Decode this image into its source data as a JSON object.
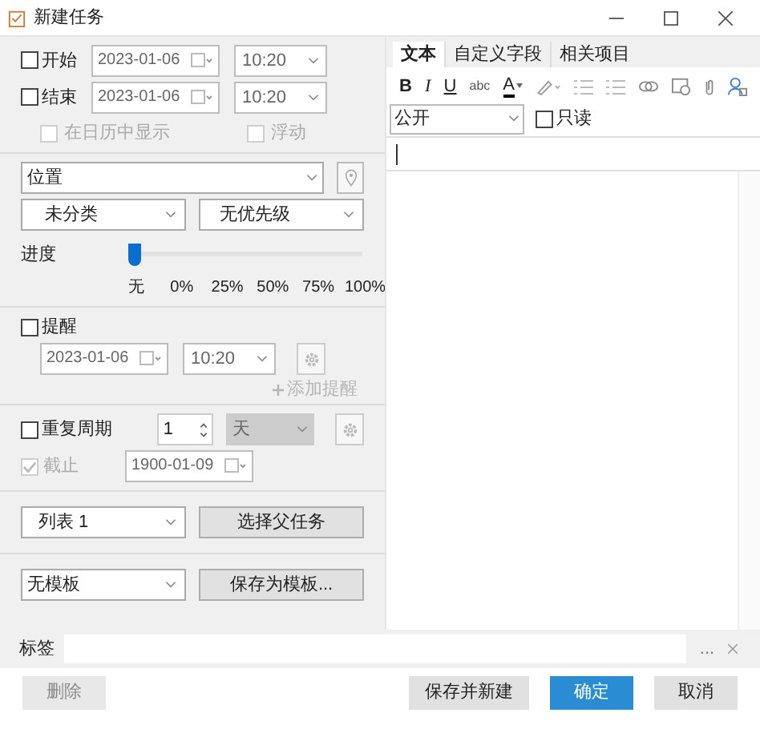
{
  "window": {
    "title": "新建任务"
  },
  "schedule": [
    {
      "label": "开始",
      "checked": false,
      "date": "2023-01-06",
      "time": "10:20"
    },
    {
      "label": "结束",
      "checked": false,
      "date": "2023-01-06",
      "time": "10:20"
    }
  ],
  "options": [
    {
      "label": "在日历中显示",
      "checked": false,
      "disabled": true
    },
    {
      "label": "浮动",
      "checked": false,
      "disabled": true
    }
  ],
  "location": {
    "placeholder": "位置"
  },
  "category": "未分类",
  "priority": "无优先级",
  "progress": {
    "label": "进度",
    "level": 0,
    "ticks": [
      "无",
      "0%",
      "25%",
      "50%",
      "75%",
      "100%"
    ]
  },
  "reminder": {
    "label": "提醒",
    "checked": false,
    "date": "2023-01-06",
    "time": "10:20",
    "add_label": "添加提醒",
    "add_disabled": true
  },
  "recurrence": {
    "label": "重复周期",
    "checked": false,
    "count": "1",
    "unit": "天",
    "unit_disabled": true,
    "until": {
      "label": "截止",
      "checked": true,
      "disabled": true,
      "date": "1900-01-09"
    }
  },
  "list": {
    "value": "列表 1",
    "button": "选择父任务"
  },
  "template": {
    "value": "无模板",
    "button": "保存为模板..."
  },
  "tabs": [
    {
      "label": "文本",
      "selected": true
    },
    {
      "label": "自定义字段",
      "selected": false
    },
    {
      "label": "相关项目",
      "selected": false
    }
  ],
  "toolbar": [
    {
      "kind": "bold",
      "text": "B"
    },
    {
      "kind": "italic",
      "text": "I"
    },
    {
      "kind": "underline",
      "text": "U"
    },
    {
      "kind": "strike",
      "text": "abc"
    },
    {
      "kind": "color",
      "text": "A"
    },
    {
      "kind": "highlight"
    },
    {
      "kind": "bullets"
    },
    {
      "kind": "numbers"
    },
    {
      "kind": "link"
    },
    {
      "kind": "date"
    },
    {
      "kind": "attach"
    },
    {
      "kind": "contact"
    }
  ],
  "visibility": "公开",
  "readonly": {
    "label": "只读",
    "checked": false
  },
  "tags": {
    "label": "标签",
    "more": "..."
  },
  "buttons": [
    {
      "label": "删除",
      "disabled": true,
      "primary": false
    },
    {
      "label": "保存并新建",
      "disabled": false,
      "primary": false
    },
    {
      "label": "确定",
      "disabled": false,
      "primary": true
    },
    {
      "label": "取消",
      "disabled": false,
      "primary": false
    }
  ]
}
